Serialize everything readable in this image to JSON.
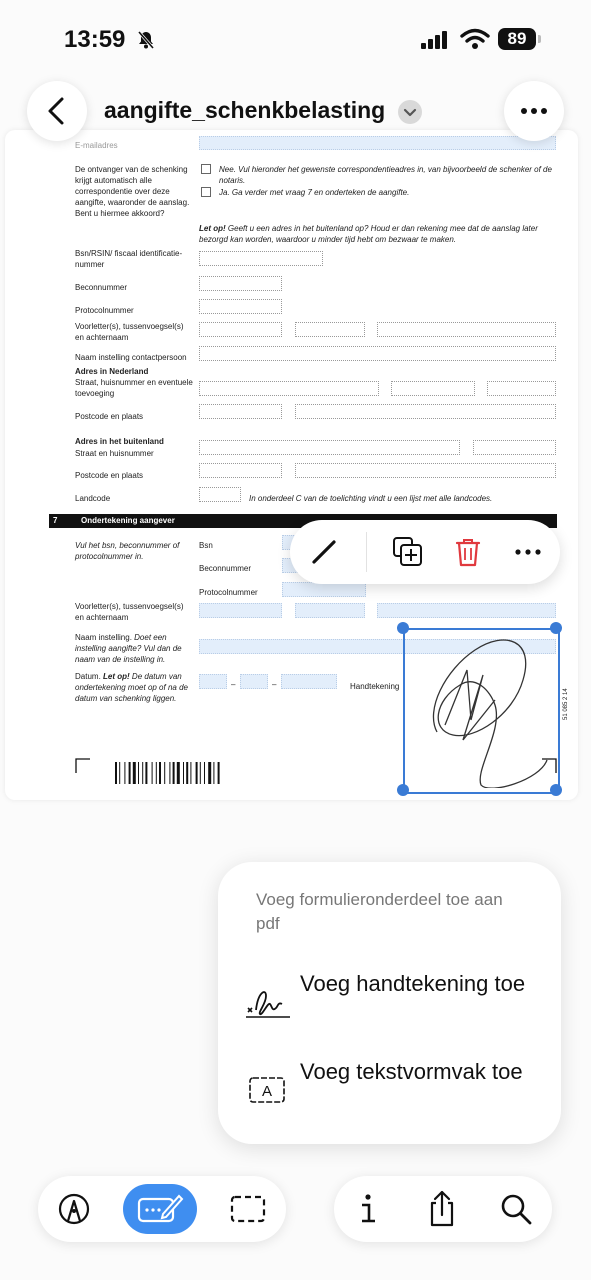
{
  "status": {
    "time": "13:59",
    "battery": "89"
  },
  "nav": {
    "title": "aangifte_schenkbelasting"
  },
  "form": {
    "email_label": "E-mailadres",
    "correspondence_label": "De ontvanger van de schenking krijgt automatisch alle correspondentie over deze aangifte, waaronder de aanslag. Bent u hiermee akkoord?",
    "option_no": "Nee. Vul hieronder het gewenste correspondentieadres in, van bijvoorbeeld de schenker of de notaris.",
    "option_yes": "Ja. Ga verder met vraag 7 en onderteken de aangifte.",
    "letop_bold": "Let op!",
    "letop_text": " Geeft u een adres in het buitenland op? Houd er dan rekening mee dat de aanslag later bezorgd kan worden, waardoor u minder tijd hebt om bezwaar te maken.",
    "bsn_rsin": "Bsn/RSIN/ fiscaal identificatie-nummer",
    "beconnummer": "Beconnummer",
    "protocolnummer": "Protocolnummer",
    "voorletters": "Voorletter(s), tussenvoegsel(s) en achternaam",
    "naam_instelling_contact": "Naam instelling contactpersoon",
    "adres_nl_head": "Adres in Nederland",
    "adres_nl_street": "Straat, huisnummer en eventuele toevoeging",
    "postcode_plaats": "Postcode en plaats",
    "adres_bl_head": "Adres in het buitenland",
    "adres_bl_street": "Straat en huisnummer",
    "postcode_plaats_2": "Postcode en plaats",
    "landcode": "Landcode",
    "landcode_note": "In onderdeel C van de toelichting vindt u een lijst met alle landcodes.",
    "section_num": "7",
    "section_title": "Ondertekening aangever",
    "vul_het": "Vul het bsn, beconnummer of protocolnummer in.",
    "bsn": "Bsn",
    "beconnummer_2": "Beconnummer",
    "protocolnummer_2": "Protocolnummer",
    "voorletters_2": "Voorletter(s), tussenvoegsel(s) en achternaam",
    "naam_instelling": "Naam instelling.",
    "naam_instelling_note": " Doet een instelling aangifte? Vul dan de naam van de instelling in.",
    "datum": "Datum.",
    "datum_letop": " Let op!",
    "datum_note": " De datum van ondertekening moet op of na de datum van schenking liggen.",
    "handtekening": "Handtekening",
    "side_code": "51 085 2 14"
  },
  "popup": {
    "header": "Voeg formulieronderdeel toe aan pdf",
    "items": [
      {
        "label": "Voeg handtekening toe",
        "icon": "signature-icon"
      },
      {
        "label": "Voeg tekstvormvak toe",
        "icon": "textbox-icon"
      }
    ]
  },
  "toolbar": {
    "left": [
      "markup-pen-icon",
      "form-sign-icon",
      "selection-icon"
    ],
    "right": [
      "info-icon",
      "share-icon",
      "search-icon"
    ]
  }
}
